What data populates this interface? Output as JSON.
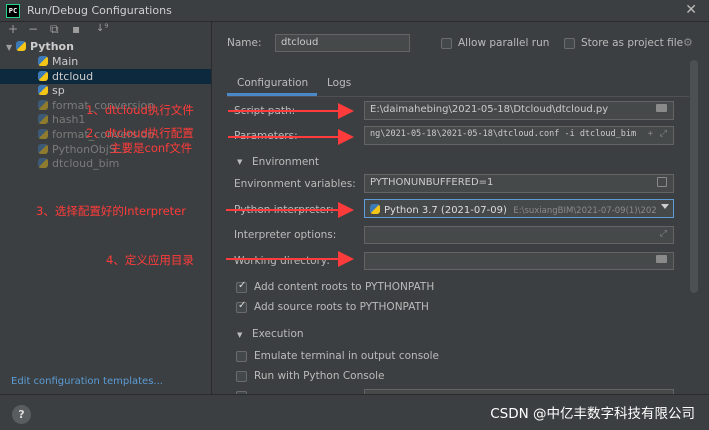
{
  "window": {
    "title": "Run/Debug Configurations",
    "app_icon_text": "PC",
    "close_glyph": "✕"
  },
  "toolbar": {
    "add": "+",
    "remove": "−",
    "copy": "⧉",
    "folder": "▪",
    "sort": "↓⁹"
  },
  "tree": {
    "root": "Python",
    "items": [
      {
        "label": "Main",
        "dim": false,
        "selected": false
      },
      {
        "label": "dtcloud",
        "dim": false,
        "selected": true
      },
      {
        "label": "sp",
        "dim": false,
        "selected": false
      },
      {
        "label": "format_conversion",
        "dim": true,
        "selected": false
      },
      {
        "label": "hash1",
        "dim": true,
        "selected": false
      },
      {
        "label": "format_conversion",
        "dim": true,
        "selected": false
      },
      {
        "label": "PythonObjS...",
        "dim": true,
        "selected": false
      },
      {
        "label": "dtcloud_bim",
        "dim": true,
        "selected": false
      }
    ],
    "edit_templates": "Edit configuration templates..."
  },
  "config": {
    "name_label": "Name:",
    "name_value": "dtcloud",
    "allow_parallel": "Allow parallel run",
    "store_project": "Store as project file",
    "tab_configuration": "Configuration",
    "tab_logs": "Logs",
    "script_path_label": "Script path:",
    "script_path_value": "E:\\daimahebing\\2021-05-18\\Dtcloud\\dtcloud.py",
    "parameters_label": "Parameters:",
    "parameters_value": "ng\\2021-05-18\\2021-05-18\\dtcloud.conf -i dtcloud_bim",
    "environment_section": "Environment",
    "env_vars_label": "Environment variables:",
    "env_vars_value": "PYTHONUNBUFFERED=1",
    "interpreter_label": "Python interpreter:",
    "interpreter_value": "Python 3.7 (2021-07-09)",
    "interpreter_path": "E:\\suxiangBIM\\2021-07-09(1)\\202",
    "interp_options_label": "Interpreter options:",
    "working_dir_label": "Working directory:",
    "add_content_roots": "Add content roots to PYTHONPATH",
    "add_source_roots": "Add source roots to PYTHONPATH",
    "execution_section": "Execution",
    "emulate_terminal": "Emulate terminal in output console",
    "run_with_console": "Run with Python Console"
  },
  "annotations": {
    "a1": "1、dtcloud执行文件",
    "a2_line1": "2、dtcloud执行配置",
    "a2_line2": "主要是conf文件",
    "a3": "3、选择配置好的Interpreter",
    "a4": "4、定义应用目录"
  },
  "footer": {
    "help": "?",
    "watermark": "CSDN @中亿丰数字科技有限公司"
  },
  "colors": {
    "annotation": "#ff3b3b",
    "accent": "#4a88c7",
    "selection": "#0d293e"
  }
}
